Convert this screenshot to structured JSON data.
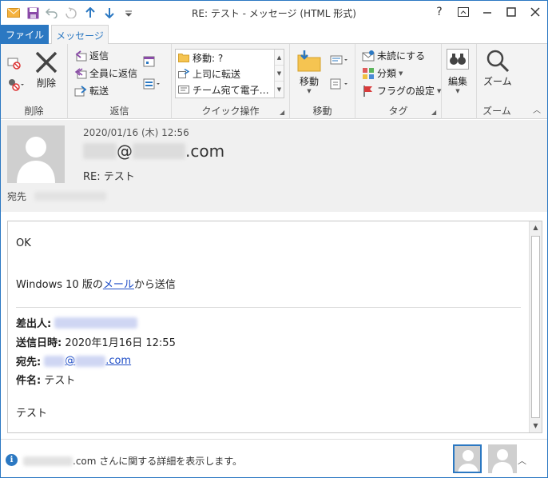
{
  "window": {
    "title": "RE: テスト - メッセージ (HTML 形式)",
    "help": "?",
    "restore": "⧉",
    "minimize": "—",
    "maximize": "☐",
    "close": "✕"
  },
  "tabs": {
    "file": "ファイル",
    "message": "メッセージ"
  },
  "ribbon": {
    "delete_group": {
      "label": "削除",
      "delete_button": "削除"
    },
    "respond_group": {
      "label": "返信",
      "reply": "返信",
      "reply_all": "全員に返信",
      "forward": "転送"
    },
    "quick_steps": {
      "label": "クイック操作",
      "items": [
        "移動: ?",
        "上司に転送",
        "チーム宛て電子…"
      ]
    },
    "move_group": {
      "label": "移動",
      "move_button": "移動"
    },
    "tags_group": {
      "label": "タグ",
      "unread": "未読にする",
      "categorize": "分類",
      "flag": "フラグの設定"
    },
    "edit_group": {
      "label": "",
      "edit_button": "編集"
    },
    "zoom_group": {
      "label": "ズーム",
      "zoom_button": "ズーム"
    }
  },
  "header": {
    "date": "2020/01/16 (木) 12:56",
    "from_at": "@",
    "from_domain_tail": ".com",
    "subject": "RE: テスト",
    "to_label": "宛先"
  },
  "body": {
    "greeting": "OK",
    "sent_from_prefix": "Windows 10 版の",
    "sent_from_link": "メール",
    "sent_from_suffix": "から送信",
    "from_label": "差出人:",
    "sent_label": "送信日時:",
    "sent_value": "2020年1月16日 12:55",
    "to_label": "宛先:",
    "to_at": "@",
    "to_tail": ".com",
    "subject_label": "件名:",
    "subject_value": "テスト",
    "body_text": "テスト"
  },
  "people_pane": {
    "info_icon": "i",
    "text_tail": ".com さんに関する詳細を表示します。",
    "chevron": "︿"
  },
  "colors": {
    "accent": "#2b78c2",
    "link": "#1f4ec7",
    "ribbon_bg": "#f3f3f3",
    "header_bg": "#f0f0f0"
  }
}
